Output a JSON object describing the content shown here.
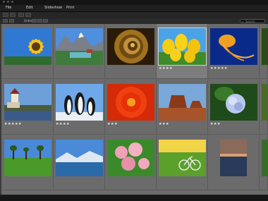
{
  "menu": [
    "File",
    "Edit",
    "Slideshow",
    "Print"
  ],
  "toolbar": {
    "filter_label": "Order",
    "search_placeholder": "Search"
  },
  "thumbnails": [
    {
      "name": "sunflower",
      "rating": "",
      "selected": false
    },
    {
      "name": "mountain-lake",
      "rating": "",
      "selected": false
    },
    {
      "name": "spiral-shell",
      "rating": "",
      "selected": false
    },
    {
      "name": "yellow-tulips",
      "rating": "★★★★",
      "selected": true
    },
    {
      "name": "jellyfish",
      "rating": "★★★★★",
      "selected": false
    },
    {
      "name": "partial-1",
      "rating": "",
      "selected": false
    },
    {
      "name": "lighthouse",
      "rating": "★★★★★",
      "selected": false
    },
    {
      "name": "penguins",
      "rating": "★★★★",
      "selected": false
    },
    {
      "name": "red-chrysanthemum",
      "rating": "★★★",
      "selected": false
    },
    {
      "name": "desert-mesa",
      "rating": "★★★",
      "selected": false
    },
    {
      "name": "hydrangea",
      "rating": "★★★",
      "selected": false
    },
    {
      "name": "partial-2",
      "rating": "",
      "selected": false
    },
    {
      "name": "field-trees",
      "rating": "",
      "selected": false
    },
    {
      "name": "winter-lake",
      "rating": "",
      "selected": false
    },
    {
      "name": "pink-blossoms",
      "rating": "",
      "selected": false
    },
    {
      "name": "bicycle-field",
      "rating": "",
      "selected": false
    },
    {
      "name": "sunset-sea",
      "rating": "",
      "selected": false
    },
    {
      "name": "partial-3",
      "rating": "",
      "selected": false
    }
  ],
  "colors": {
    "grid_bg": "#6b6b6b",
    "selected_cell": "#7d7d7d"
  }
}
